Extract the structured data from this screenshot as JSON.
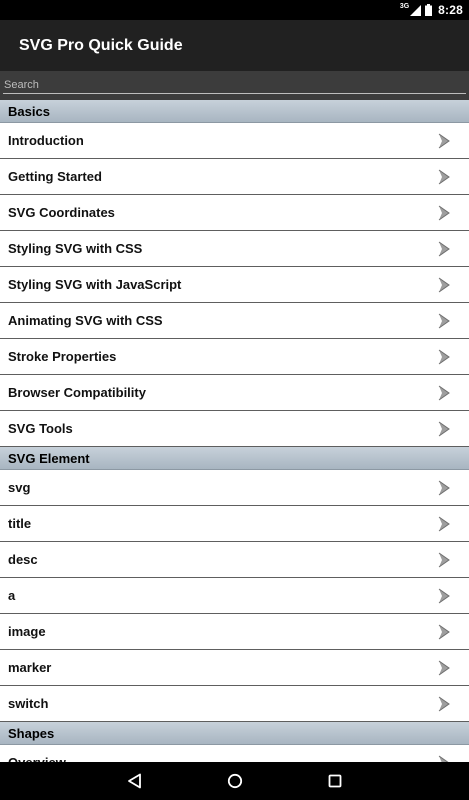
{
  "status_bar": {
    "network": "3G",
    "time": "8:28"
  },
  "app_bar": {
    "title": "SVG Pro Quick Guide"
  },
  "search": {
    "placeholder": "Search",
    "value": ""
  },
  "sections": [
    {
      "title": "Basics",
      "items": [
        "Introduction",
        "Getting Started",
        "SVG Coordinates",
        "Styling SVG with CSS",
        "Styling SVG with JavaScript",
        "Animating SVG with CSS",
        "Stroke Properties",
        "Browser Compatibility",
        "SVG Tools"
      ]
    },
    {
      "title": "SVG Element",
      "items": [
        "svg",
        "title",
        "desc",
        "a",
        "image",
        "marker",
        "switch"
      ]
    },
    {
      "title": "Shapes",
      "items": [
        "Overview"
      ]
    }
  ],
  "icons": {
    "list_item_chevron": "chevron-right-icon",
    "nav_back": "back-icon",
    "nav_home": "home-icon",
    "nav_recents": "recents-icon"
  },
  "colors": {
    "app_bar": "#212121",
    "search_bar": "#3c3c3c",
    "section_header_top": "#c7d1da",
    "section_header_bottom": "#a8b5c1",
    "divider": "#5e5e5e"
  }
}
